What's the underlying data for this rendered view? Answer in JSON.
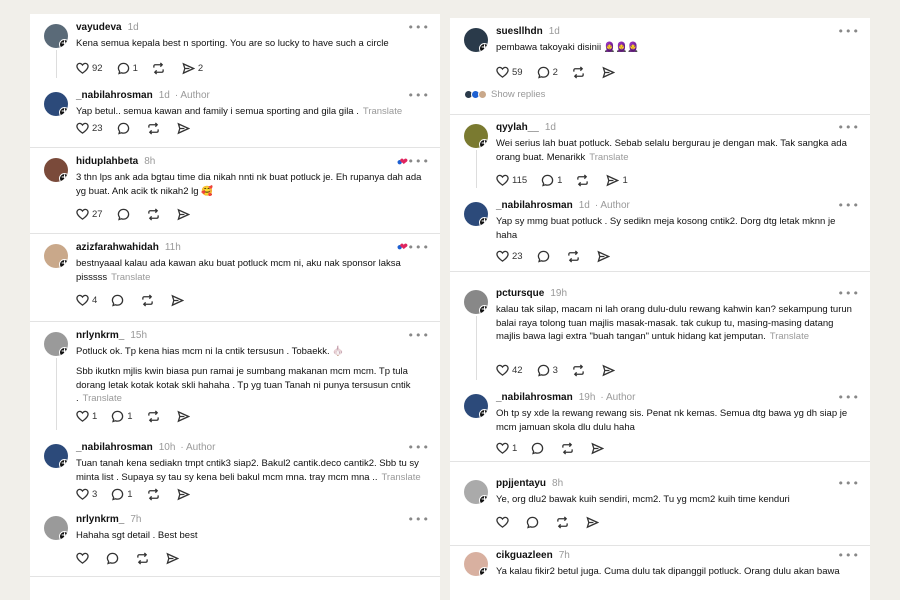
{
  "left": {
    "posts": [
      {
        "user": "vayudeva",
        "time": "1d",
        "author": "",
        "text": "Kena semua kepala best n sporting. You are so lucky to have such a circle",
        "translate": "",
        "likes": "92",
        "replies": "1",
        "reposts": "",
        "shares": "2"
      },
      {
        "user": "_nabilahrosman",
        "time": "1d",
        "author": "· Author",
        "text": "Yap betul.. semua kawan and family i semua sporting and gila gila .",
        "translate": "Translate",
        "likes": "23",
        "replies": "",
        "reposts": "",
        "shares": ""
      },
      {
        "user": "hiduplahbeta",
        "time": "8h",
        "author": "",
        "text": "3 thn lps ank ada bgtau time dia nikah nnti nk buat potluck je. Eh rupanya dah ada yg buat. Ank acik tk nikah2 lg 🥰",
        "translate": "",
        "likes": "27",
        "replies": "",
        "reposts": "",
        "shares": ""
      },
      {
        "user": "azizfarahwahidah",
        "time": "11h",
        "author": "",
        "text": "bestnyaaal kalau ada kawan aku buat potluck mcm ni, aku nak sponsor laksa pisssss",
        "translate": "Translate",
        "likes": "4",
        "replies": "",
        "reposts": "",
        "shares": ""
      },
      {
        "user": "nrlynkrm_",
        "time": "15h",
        "author": "",
        "text": "Potluck ok. Tp kena hias mcm ni la cntik tersusun . Tobaekk. 🧄",
        "text2": "Sbb ikutkn mjlis kwin biasa pun ramai je sumbang makanan mcm mcm. Tp tula dorang letak kotak kotak skli hahaha . Tp yg tuan Tanah ni punya tersusun cntik .",
        "translate": "Translate",
        "likes": "1",
        "replies": "1",
        "reposts": "",
        "shares": ""
      },
      {
        "user": "_nabilahrosman",
        "time": "10h",
        "author": "· Author",
        "text": "Tuan tanah kena sediakn tmpt cntik3 siap2. Bakul2 cantik.deco cantik2. Sbb tu sy minta list . Supaya sy tau sy kena beli bakul mcm mna. tray mcm mna ..",
        "translate": "Translate",
        "likes": "3",
        "replies": "1",
        "reposts": "",
        "shares": ""
      },
      {
        "user": "nrlynkrm_",
        "time": "7h",
        "author": "",
        "text": "Hahaha sgt detail . Best best",
        "translate": "",
        "likes": "",
        "replies": "",
        "reposts": "",
        "shares": ""
      }
    ]
  },
  "right": {
    "posts": [
      {
        "user": "suesllhdn",
        "time": "1d",
        "author": "",
        "text": "pembawa takoyaki disinii 🧕🧕🧕",
        "translate": "",
        "likes": "59",
        "replies": "2",
        "reposts": "",
        "shares": ""
      },
      {
        "user": "qyylah__",
        "time": "1d",
        "author": "",
        "text": "Wei serius lah buat potluck. Sebab selalu bergurau je dengan mak. Tak sangka ada orang buat. Menarikk",
        "translate": "Translate",
        "likes": "115",
        "replies": "1",
        "reposts": "",
        "shares": "1"
      },
      {
        "user": "_nabilahrosman",
        "time": "1d",
        "author": "· Author",
        "text": "Yap sy mmg buat potluck . Sy sedikn meja kosong cntik2. Dorg dtg letak mknn je haha",
        "translate": "",
        "likes": "23",
        "replies": "",
        "reposts": "",
        "shares": ""
      },
      {
        "user": "pctursque",
        "time": "19h",
        "author": "",
        "text": "kalau tak silap, macam ni lah orang dulu-dulu rewang kahwin kan? sekampung turun balai raya tolong tuan majlis masak-masak. tak cukup tu, masing-masing datang majlis bawa lagi extra \"buah tangan\" untuk hidang kat jemputan.",
        "translate": "Translate",
        "likes": "42",
        "replies": "3",
        "reposts": "",
        "shares": ""
      },
      {
        "user": "_nabilahrosman",
        "time": "19h",
        "author": "· Author",
        "text": "Oh tp sy xde la rewang rewang sis. Penat nk kemas. Semua dtg bawa yg dh siap je mcm jamuan skola dlu dulu haha",
        "translate": "",
        "likes": "1",
        "replies": "",
        "reposts": "",
        "shares": ""
      },
      {
        "user": "ppjjentayu",
        "time": "8h",
        "author": "",
        "text": "Ye, org dlu2 bawak kuih sendiri, mcm2. Tu yg mcm2 kuih time kenduri",
        "translate": "",
        "likes": "",
        "replies": "",
        "reposts": "",
        "shares": ""
      },
      {
        "user": "cikguazleen",
        "time": "7h",
        "author": "",
        "text": "Ya kalau fikir2 betul juga. Cuma dulu tak dipanggil potluck. Orang dulu akan bawa",
        "translate": "",
        "likes": "",
        "replies": "",
        "reposts": "",
        "shares": ""
      }
    ],
    "show_replies": "Show replies"
  },
  "colors": {
    "avatar1": "#5a6a78",
    "avatar2": "#2c4a7a",
    "avatar3": "#7a4a3a",
    "avatar4": "#c9a88a",
    "avatar5": "#9a9a9a",
    "avatar6": "#2a3a4a",
    "avatar7": "#7a7a30",
    "avatar8": "#888888",
    "avatar9": "#aaaaaa",
    "avatar10": "#d8b0a0"
  }
}
